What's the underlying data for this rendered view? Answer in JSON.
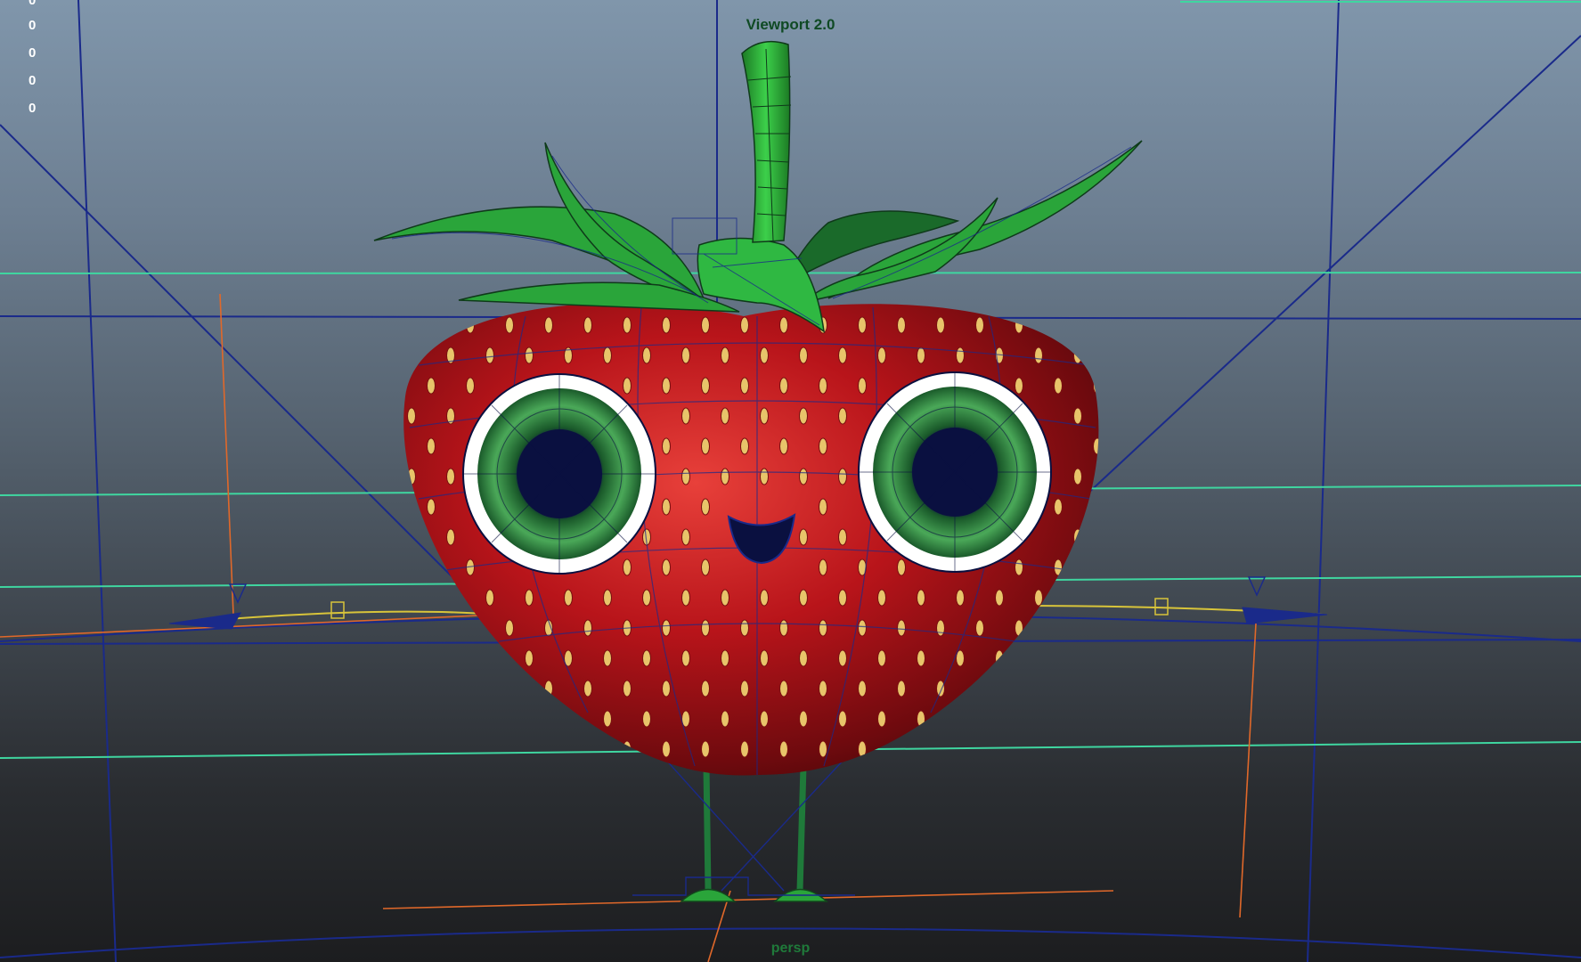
{
  "viewport": {
    "renderer_label": "Viewport 2.0",
    "camera_label": "persp",
    "hud_counters": [
      "0",
      "0",
      "0",
      "0",
      "0"
    ]
  },
  "colors": {
    "grid_blue": "#1a2a8a",
    "grid_green": "#3fd6a0",
    "strawberry_red": "#c0161a",
    "seed_yellow": "#e8c46a",
    "stem_green": "#2aa53a",
    "eye_white": "#ffffff",
    "iris_green": "#1f7a3a",
    "pupil_navy": "#0a1040",
    "locator_orange": "#e0682a",
    "ik_yellow": "#d8c43a"
  }
}
